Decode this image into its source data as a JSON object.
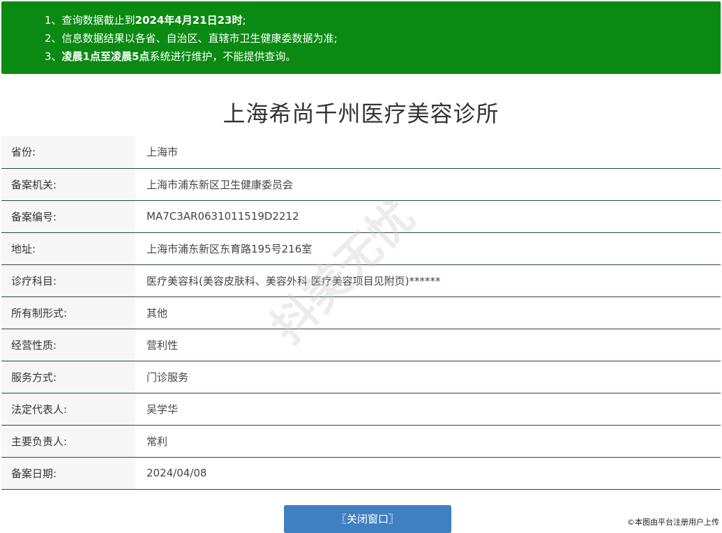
{
  "notice": {
    "line1_pre": "1、查询数据截止到",
    "line1_bold": "2024年4月21日23时",
    "line1_post": ";",
    "line2": "2、信息数据结果以各省、自治区、直辖市卫生健康委数据为准;",
    "line3_pre": "3、",
    "line3_bold": "凌晨1点至凌晨5点",
    "line3_post": "系统进行维护，不能提供查询。"
  },
  "title": "上海希尚千州医疗美容诊所",
  "rows": [
    {
      "label": "省份:",
      "value": "上海市"
    },
    {
      "label": "备案机关:",
      "value": "上海市浦东新区卫生健康委员会"
    },
    {
      "label": "备案编号:",
      "value": "MA7C3AR0631011519D2212"
    },
    {
      "label": "地址:",
      "value": "上海市浦东新区东育路195号216室"
    },
    {
      "label": "诊疗科目:",
      "value": "医疗美容科(美容皮肤科、美容外科 医疗美容项目见附页)******"
    },
    {
      "label": "所有制形式:",
      "value": "其他"
    },
    {
      "label": "经营性质:",
      "value": "营利性"
    },
    {
      "label": "服务方式:",
      "value": "门诊服务"
    },
    {
      "label": "法定代表人:",
      "value": "吴学华"
    },
    {
      "label": "主要负责人:",
      "value": "常利"
    },
    {
      "label": "备案日期:",
      "value": "2024/04/08"
    }
  ],
  "close_button": "〖关闭窗口〗",
  "watermark": "抖美无忧",
  "copyright": "©本图由平台注册用户上传",
  "colors": {
    "notice_bg": "#0a8a12",
    "button_bg": "#3f80c1",
    "row_border": "#1f4f3a"
  }
}
